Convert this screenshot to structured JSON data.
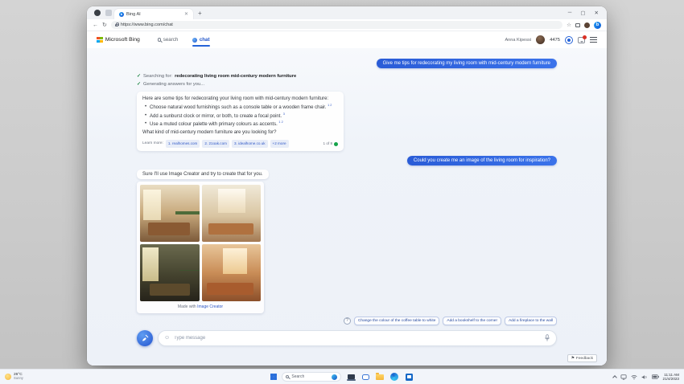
{
  "window": {
    "tab_title": "Bing AI",
    "url": "https://www.bing.com/chat",
    "controls": {
      "minimize": "─",
      "maximize": "▢",
      "close": "✕",
      "close_tab": "✕",
      "new_tab": "+",
      "back": "←",
      "refresh": "↻",
      "star": "☆"
    }
  },
  "bing": {
    "brand": "Microsoft Bing",
    "nav_search": "search",
    "nav_chat": "chat",
    "account_name": "Anna Kipessi",
    "points": "4475",
    "discover_letter": "b"
  },
  "chat": {
    "user_message_1": "Give me tips for redecorating my living room with mid-century modern furniture",
    "status_searching_label": "Searching for:",
    "status_searching_query": "redecorating living room mid-century modern furniture",
    "status_generating": "Generating answers for you...",
    "answer": {
      "intro": "Here are some tips for redecorating your living room with mid-century modern furniture:",
      "bullets": [
        {
          "text": "Choose natural wood furnishings such as a console table or a wooden frame chair.",
          "refs": "1 2"
        },
        {
          "text": "Add a sunburst clock or mirror, or both, to create a focal point.",
          "refs": "3"
        },
        {
          "text": "Use a muted colour palette with primary colours as accents.",
          "refs": "1 2"
        }
      ],
      "question": "What kind of mid-century modern furniture are you looking for?",
      "learn_more_label": "Learn more:",
      "sources": [
        "1. realhomes.com",
        "2. 21oak.com",
        "3. idealhome.co.uk",
        "+2 more"
      ],
      "pager": "1 of 8"
    },
    "user_message_2": "Could you create me an image of the living room for inspiration?",
    "image_reply_intro": "Sure I'll use Image Creator and try to create that for you.",
    "image_caption_prefix": "Made with",
    "image_caption_link": "Image Creator",
    "help_glyph": "?",
    "suggestions": [
      "Change the colour of the coffee table to white",
      "Add a bookshelf to the corner",
      "Add a fireplace to the wall"
    ],
    "composer_placeholder": "Type message",
    "emoji_glyph": "☺",
    "feedback_label": "Feedback",
    "feedback_glyph": "⚑"
  },
  "taskbar": {
    "weather_temp": "26°C",
    "weather_condition": "Sunny",
    "search_placeholder": "Search",
    "time": "11:11 AM",
    "date": "21/4/2023"
  },
  "colors": {
    "accent_blue": "#2563d8",
    "user_bubble_blue": "#2a5cd7",
    "success_green": "#15803d",
    "notification_red": "#d93025",
    "chat_background": "#edf1f8"
  }
}
